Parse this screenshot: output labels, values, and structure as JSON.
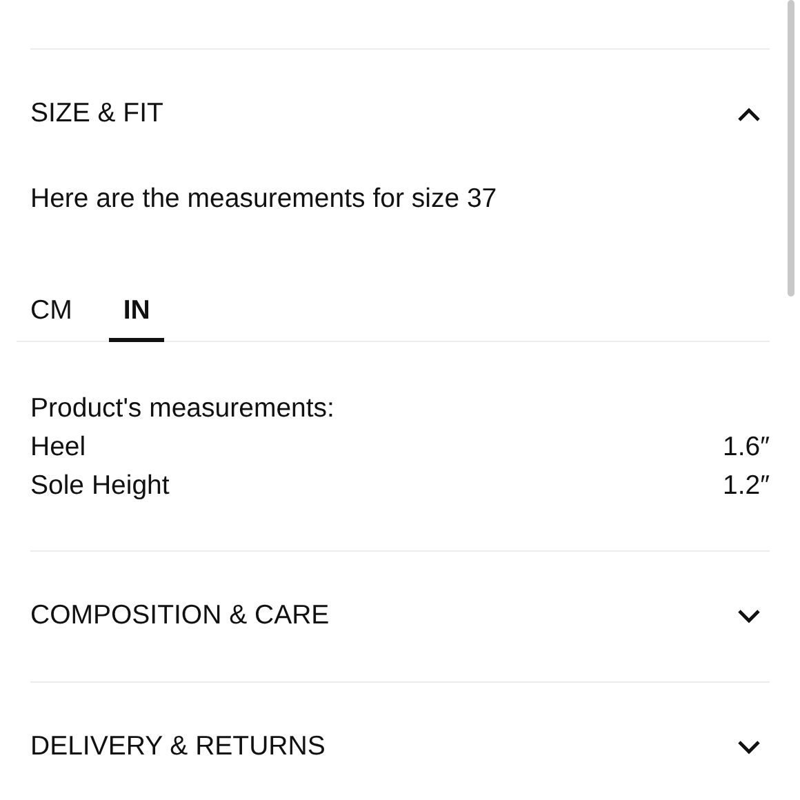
{
  "sections": [
    {
      "title": "SIZE & FIT",
      "expanded": true,
      "intro": "Here are the measurements for size 37",
      "unit_tabs": [
        {
          "label": "CM",
          "selected": false
        },
        {
          "label": "IN",
          "selected": true
        }
      ],
      "measurements_heading": "Product's measurements:",
      "measurements": [
        {
          "name": "Heel",
          "value": "1.6″"
        },
        {
          "name": "Sole Height",
          "value": "1.2″"
        }
      ]
    },
    {
      "title": "COMPOSITION & CARE",
      "expanded": false
    },
    {
      "title": "DELIVERY & RETURNS",
      "expanded": false
    }
  ]
}
